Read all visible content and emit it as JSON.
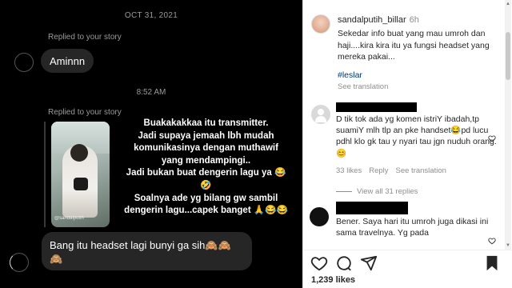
{
  "dm": {
    "date": "OCT 31, 2021",
    "replied_1": "Replied to your story",
    "msg_1": "Aminnn",
    "time": "8:52 AM",
    "replied_2": "Replied to your story",
    "story_caption": "@sandalputih",
    "story_reply_lines": [
      "Buakakakkaa itu transmitter.",
      "Jadi supaya jemaah lbh mudah",
      "komunikasinya dengan muthawif",
      "yang mendampingi..",
      "Jadi bukan buat dengerin lagu ya 😂",
      "🤣",
      "Soalnya ade yg bilang gw sambil",
      "dengerin lagu...capek banget 🙏😂😂"
    ],
    "msg_last_line1": "Bang itu headset lagi bunyi ga sih🙈🙈",
    "msg_last_line2": "🙈"
  },
  "ig": {
    "post_user": "sandalputih_billar",
    "post_time": "6h",
    "post_caption": "Sekedar info buat yang mau umroh dan haji....kira kira itu ya fungsi headset yang mereka pakai...",
    "hashtag": "#leslar",
    "see_translation": "See translation",
    "comment1_text": "D tik tok ada yg komen istriY ibadah,tp suamiY mlh tlp an pke handset😂pd lucu pdhl klo gk tau y nyari tau jgn nuduh orang.😊",
    "comment1_likes": "33 likes",
    "comment1_reply": "Reply",
    "comment1_see_tr": "See translation",
    "view_all": "View all 31 replies",
    "comment2_text": "Bener. Saya hari itu umroh juga dikasi ini sama travelnya. Yg pada",
    "likes": "1,239 likes"
  },
  "colors": {
    "dm_bg": "#000000",
    "bubble": "#262626",
    "hashtag": "#00376b",
    "muted": "#8e8e8e"
  }
}
